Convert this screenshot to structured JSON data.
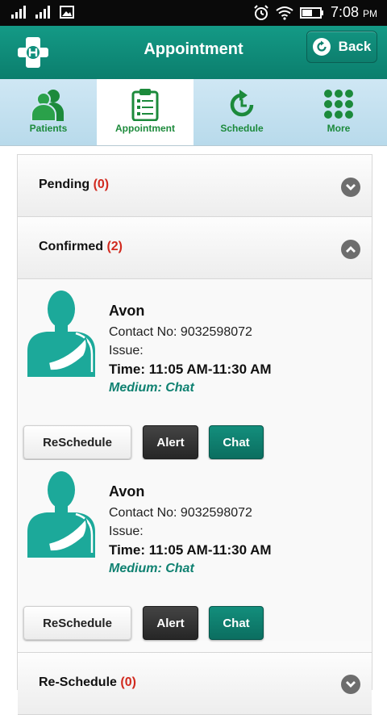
{
  "status_bar": {
    "time": "7:08",
    "ampm": "PM"
  },
  "app_bar": {
    "title": "Appointment",
    "back_label": "Back"
  },
  "colors": {
    "accent": "#0f8f7c",
    "tab_green": "#1c8a3b",
    "count_red": "#d12a1f"
  },
  "tabs": [
    {
      "label": "Patients",
      "icon": "patients-icon",
      "active": false
    },
    {
      "label": "Appointment",
      "icon": "clipboard-icon",
      "active": true
    },
    {
      "label": "Schedule",
      "icon": "history-icon",
      "active": false
    },
    {
      "label": "More",
      "icon": "grid-icon",
      "active": false
    }
  ],
  "sections": {
    "pending": {
      "label": "Pending",
      "count": "(0)"
    },
    "confirmed": {
      "label": "Confirmed",
      "count": "(2)"
    },
    "reschedule": {
      "label": "Re-Schedule",
      "count": "(0)"
    }
  },
  "appointments": [
    {
      "name": "Avon",
      "contact": "Contact No: 9032598072",
      "issue": "Issue:",
      "time": "Time: 11:05 AM-11:30 AM",
      "medium": "Medium: Chat"
    },
    {
      "name": "Avon",
      "contact": "Contact No: 9032598072",
      "issue": "Issue:",
      "time": "Time: 11:05 AM-11:30 AM",
      "medium": "Medium: Chat"
    }
  ],
  "buttons": {
    "reschedule": "ReSchedule",
    "alert": "Alert",
    "chat": "Chat"
  }
}
